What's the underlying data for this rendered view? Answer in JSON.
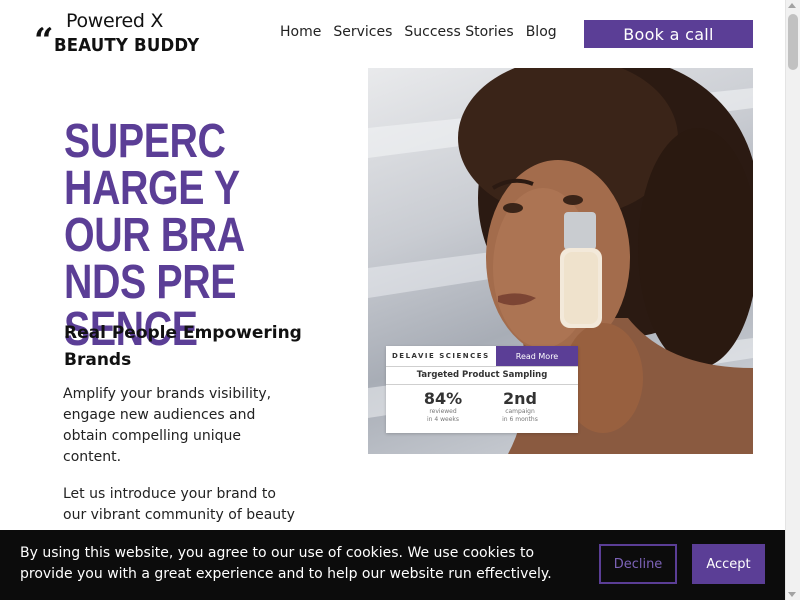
{
  "logo": {
    "top_text": "Powered X",
    "quote_mark": "“",
    "bottom_text": "BEAUTY BUDDY"
  },
  "nav": {
    "items": [
      "Home",
      "Services",
      "Success Stories",
      "Blog"
    ],
    "cta_label": "Book a call"
  },
  "hero": {
    "title": "SUPERCHARGE YOUR BRANDS PRESENCE",
    "subtitle": "Real People Empowering Brands",
    "paragraph1": "Amplify your brands visibility, engage new audiences and obtain compelling unique content.",
    "paragraph2": "Let us introduce your brand to our vibrant community of beauty"
  },
  "card": {
    "brand": "DELAVIE SCIENCES",
    "button_label": "Read More",
    "heading": "Targeted Product Sampling",
    "stats": [
      {
        "value": "84%",
        "caption_line1": "reviewed",
        "caption_line2": "in 4 weeks"
      },
      {
        "value": "2nd",
        "caption_line1": "campaign",
        "caption_line2": "in 6 months"
      }
    ]
  },
  "cookie": {
    "text": "By using this website, you agree to our use of cookies. We use cookies to provide you with a great experience and to help our website run effectively.",
    "decline_label": "Decline",
    "accept_label": "Accept"
  },
  "colors": {
    "brand_purple": "#5b3e96",
    "banner_bg": "#0c0c0c"
  }
}
